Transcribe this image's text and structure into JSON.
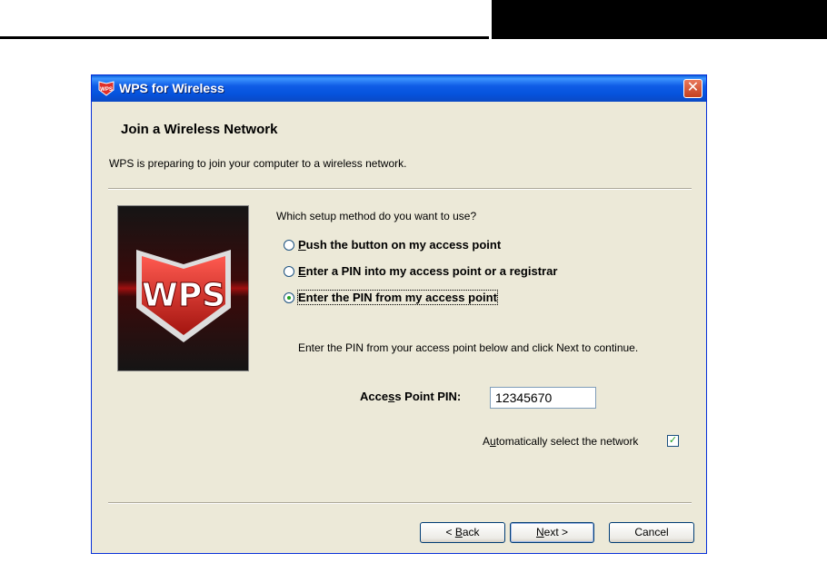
{
  "window": {
    "title": "WPS for Wireless",
    "close_glyph": "✕"
  },
  "header": {
    "title": "Join a Wireless Network",
    "subtitle": "WPS is preparing to join your computer to a wireless network."
  },
  "logo": {
    "text": "WPS",
    "colors": {
      "shield": "#d42a22",
      "background": "#1a1a1a"
    }
  },
  "setup": {
    "question": "Which setup method do you want to use?",
    "options": [
      {
        "mnemonic": "P",
        "rest": "ush the button on my access point",
        "checked": false
      },
      {
        "mnemonic": "E",
        "rest": "nter a PIN into my access point or a registrar",
        "checked": false
      },
      {
        "mnemonic": "",
        "rest": "Enter the PIN from my access point",
        "checked": true
      }
    ],
    "instruction": "Enter the PIN from your access point below and click Next to continue.",
    "pin_label_pre": "Acce",
    "pin_label_mn": "s",
    "pin_label_post": "s Point PIN:",
    "pin_value": "12345670",
    "auto_pre": "A",
    "auto_mn": "u",
    "auto_post": "tomatically select the network",
    "auto_checked": true
  },
  "buttons": {
    "back_pre": "< ",
    "back_mn": "B",
    "back_post": "ack",
    "next_mn": "N",
    "next_post": "ext >",
    "cancel": "Cancel"
  }
}
